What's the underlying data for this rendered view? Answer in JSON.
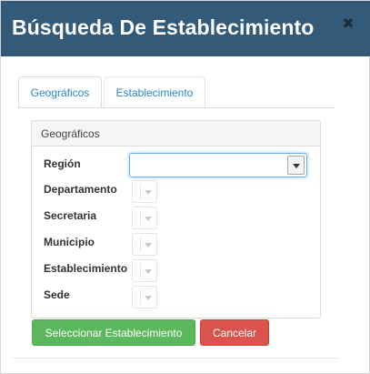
{
  "modal": {
    "title": "Búsqueda De Establecimiento",
    "close_icon": "close-icon"
  },
  "tabs": [
    {
      "label": "Geográficos",
      "active": true
    },
    {
      "label": "Establecimiento",
      "active": false
    }
  ],
  "panel": {
    "heading": "Geográficos",
    "fields": [
      {
        "label": "Región",
        "value": ""
      },
      {
        "label": "Departamento",
        "value": ""
      },
      {
        "label": "Secretaria",
        "value": ""
      },
      {
        "label": "Municipio",
        "value": ""
      },
      {
        "label": "Establecimiento",
        "value": ""
      },
      {
        "label": "Sede",
        "value": ""
      }
    ]
  },
  "buttons": {
    "select_label": "Seleccionar Establecimiento",
    "cancel_label": "Cancelar"
  },
  "colors": {
    "header": "#335a78",
    "link": "#2a86c8",
    "success": "#5cb85c",
    "danger": "#d9534f"
  }
}
